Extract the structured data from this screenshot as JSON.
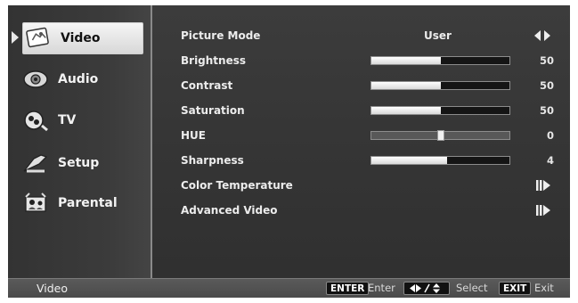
{
  "sidebar": {
    "items": [
      {
        "label": "Video",
        "icon": "video-icon",
        "active": true
      },
      {
        "label": "Audio",
        "icon": "audio-icon",
        "active": false
      },
      {
        "label": "TV",
        "icon": "tv-icon",
        "active": false
      },
      {
        "label": "Setup",
        "icon": "setup-icon",
        "active": false
      },
      {
        "label": "Parental",
        "icon": "parental-icon",
        "active": false
      }
    ]
  },
  "settings": {
    "picture_mode": {
      "label": "Picture Mode",
      "value": "User"
    },
    "brightness": {
      "label": "Brightness",
      "value": "50",
      "level": 0.5
    },
    "contrast": {
      "label": "Contrast",
      "value": "50",
      "level": 0.5
    },
    "saturation": {
      "label": "Saturation",
      "value": "50",
      "level": 0.5
    },
    "hue": {
      "label": "HUE",
      "value": "0",
      "level": 0.5
    },
    "sharpness": {
      "label": "Sharpness",
      "value": "4",
      "level": 0.55
    },
    "color_temperature": {
      "label": "Color Temperature"
    },
    "advanced_video": {
      "label": "Advanced Video"
    }
  },
  "status_bar": {
    "title": "Video",
    "enter_key": "ENTER",
    "enter_label": "Enter",
    "select_label": "Select",
    "exit_key": "EXIT",
    "exit_label": "Exit"
  },
  "colors": {
    "panel_bg": "#353535",
    "highlight_bg": "#e6e6e6",
    "bar_fill": "#ffffff",
    "bar_track": "#151515",
    "text": "#ececec"
  }
}
